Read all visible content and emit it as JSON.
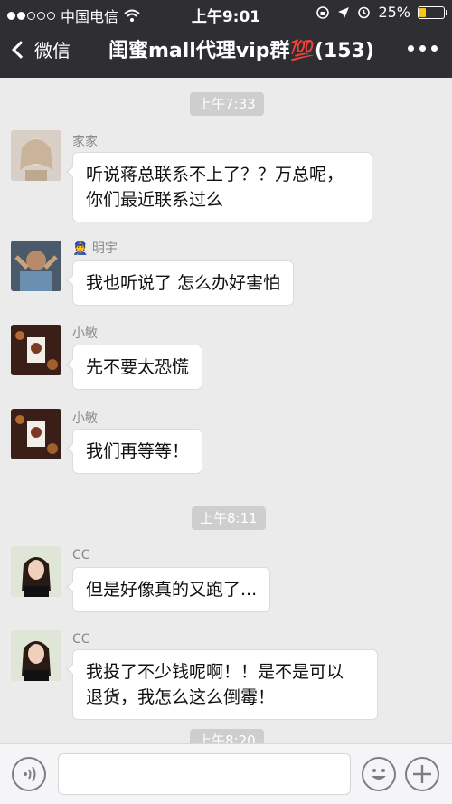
{
  "status": {
    "carrier": "中国电信",
    "time": "上午9:01",
    "battery": "25%"
  },
  "nav": {
    "back_label": "微信",
    "title": "闺蜜mall代理vip群💯(153)"
  },
  "chat": {
    "timestamps": [
      "上午7:33",
      "上午8:11",
      "上午8:20"
    ],
    "messages": [
      {
        "sender": "家家",
        "text": "听说蒋总联系不上了？？万总呢，\n你们最近联系过么"
      },
      {
        "sender": "明宇",
        "sender_prefix": "👮",
        "text": "我也听说了 怎么办好害怕"
      },
      {
        "sender": "小敏",
        "text": "先不要太恐慌"
      },
      {
        "sender": "小敏",
        "text": "我们再等等！"
      },
      {
        "sender": "CC",
        "text": "但是好像真的又跑了..."
      },
      {
        "sender": "CC",
        "text": "我投了不少钱呢啊！！是不是可以\n退货，我怎么这么倒霉！"
      }
    ]
  },
  "input": {
    "value": ""
  },
  "colors": {
    "topbar": "#2e2e33",
    "chat_bg": "#ebebeb",
    "bubble": "#ffffff",
    "battery_fill": "#f5c518"
  }
}
